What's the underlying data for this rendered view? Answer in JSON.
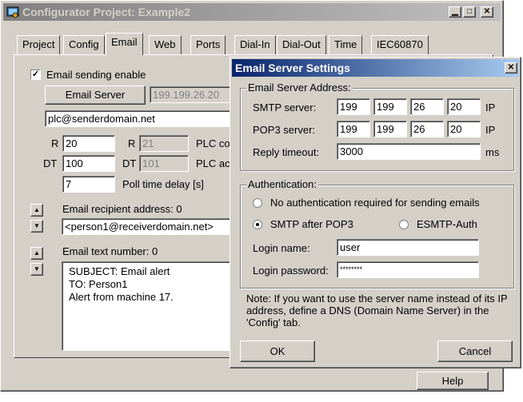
{
  "main_window": {
    "title": "Configurator Project: Example2",
    "tabs": [
      "Project",
      "Config",
      "Email",
      "Web",
      "Ports",
      "Dial-In",
      "Dial-Out",
      "Time",
      "IEC60870"
    ],
    "active_tab": "Email",
    "email_enable_label": "Email sending enable",
    "email_enable_checked": true,
    "email_server_button": "Email Server",
    "server_ip_display": "199.199.26.20",
    "sender_address": "plc@senderdomain.net",
    "r_label": "R",
    "r_value": "20",
    "r2_label": "R",
    "r2_value": "21",
    "plc_label_1": "PLC co",
    "dt_label": "DT",
    "dt_value": "100",
    "dt2_label": "DT",
    "dt2_value": "101",
    "plc_label_2": "PLC ac",
    "poll_value": "7",
    "poll_label": "Poll time delay [s]",
    "recipient_label": "Email recipient address: 0",
    "recipient_value": "<person1@receiverdomain.net>",
    "text_number_label": "Email text number: 0",
    "text_lines": [
      "SUBJECT: Email alert",
      "TO: Person1",
      "Alert from machine 17."
    ],
    "help_button": "Help"
  },
  "dialog": {
    "title": "Email Server Settings",
    "address_group": "Email Server Address:",
    "smtp_label": "SMTP server:",
    "smtp_ip": [
      "199",
      "199",
      "26",
      "20"
    ],
    "pop3_label": "POP3 server:",
    "pop3_ip": [
      "199",
      "199",
      "26",
      "20"
    ],
    "ip_suffix": "IP",
    "reply_label": "Reply timeout:",
    "reply_value": "3000",
    "reply_unit": "ms",
    "auth_group": "Authentication:",
    "auth_none_label": "No authentication required for sending emails",
    "auth_smtp_pop3_label": "SMTP after POP3",
    "auth_esmtp_label": "ESMTP-Auth",
    "auth_selected": "SMTP after POP3",
    "login_name_label": "Login name:",
    "login_name_value": "user",
    "login_password_label": "Login password:",
    "login_password_value": "********",
    "note": "Note: If you want to use the server name instead of its IP address, define a DNS (Domain Name Server) in the 'Config' tab.",
    "ok_button": "OK",
    "cancel_button": "Cancel"
  }
}
